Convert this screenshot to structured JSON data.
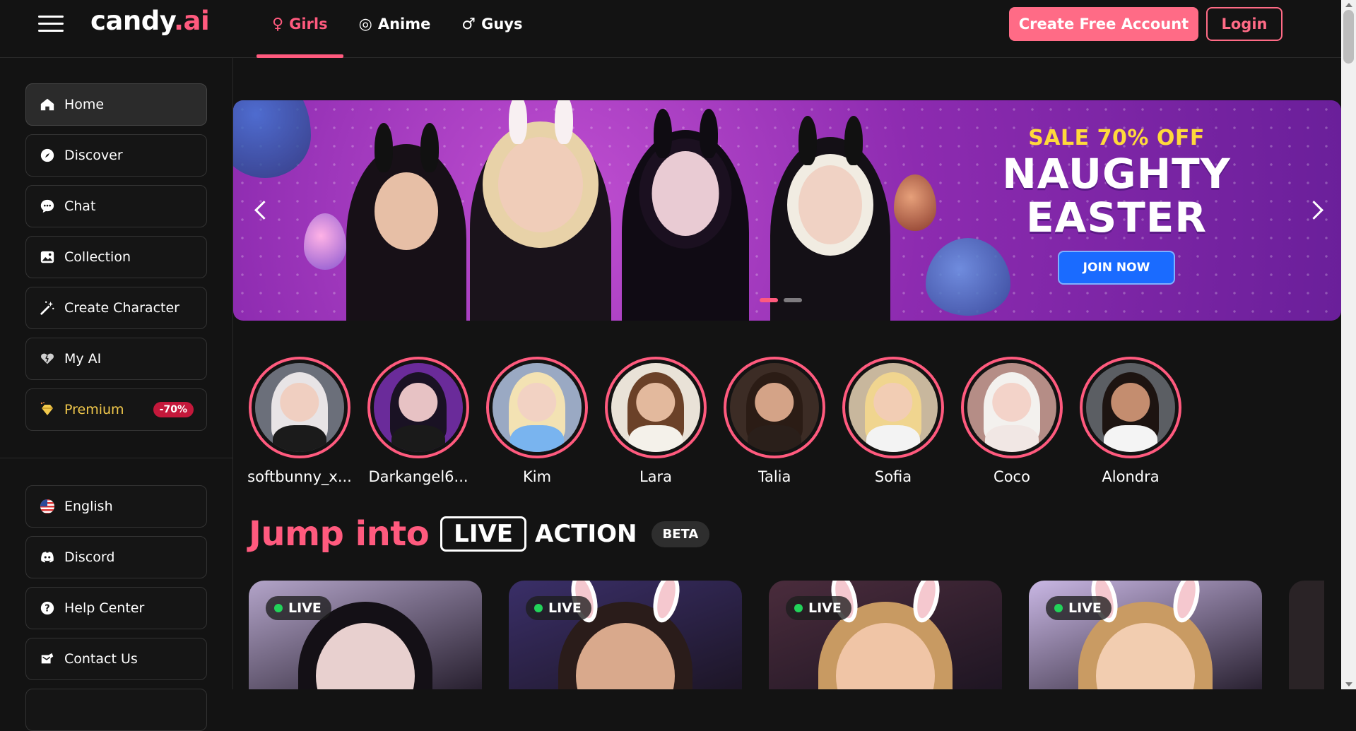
{
  "header": {
    "logo_main": "candy",
    "logo_accent": ".ai",
    "tabs": [
      {
        "label": "Girls",
        "icon": "female-icon",
        "symbol": "♀"
      },
      {
        "label": "Anime",
        "icon": "anime-icon",
        "symbol": "◎"
      },
      {
        "label": "Guys",
        "icon": "male-icon",
        "symbol": "♂"
      }
    ],
    "active_tab": "Girls",
    "create_account_label": "Create Free Account",
    "login_label": "Login"
  },
  "sidebar": {
    "items": [
      {
        "label": "Home",
        "icon": "home-icon"
      },
      {
        "label": "Discover",
        "icon": "compass-icon"
      },
      {
        "label": "Chat",
        "icon": "chat-icon"
      },
      {
        "label": "Collection",
        "icon": "image-icon"
      },
      {
        "label": "Create Character",
        "icon": "magic-wand-icon"
      },
      {
        "label": "My AI",
        "icon": "hearts-icon"
      },
      {
        "label": "Premium",
        "icon": "diamond-icon",
        "badge": "-70%"
      }
    ],
    "footer_items": [
      {
        "label": "English",
        "icon": "us-flag-icon"
      },
      {
        "label": "Discord",
        "icon": "discord-icon"
      },
      {
        "label": "Help Center",
        "icon": "help-icon"
      },
      {
        "label": "Contact Us",
        "icon": "contact-icon"
      }
    ]
  },
  "banner": {
    "sale_text": "SALE 70% OFF",
    "headline_1": "NAUGHTY",
    "headline_2": "EASTER",
    "cta_label": "JOIN NOW"
  },
  "stories": [
    {
      "name": "softbunny_x...",
      "hair": "#e8e4e6",
      "skin": "#f0cfc1",
      "bg": "#6b6f7a",
      "body": "#1b1b1b"
    },
    {
      "name": "Darkangel6...",
      "hair": "#1a1224",
      "skin": "#e7c2c4",
      "bg": "#6a2b9a",
      "body": "#1a1a1a"
    },
    {
      "name": "Kim",
      "hair": "#f3e2b3",
      "skin": "#f2d2c3",
      "bg": "#9aa9c3",
      "body": "#79b4ef"
    },
    {
      "name": "Lara",
      "hair": "#6b4128",
      "skin": "#e3b99d",
      "bg": "#e9e2d7",
      "body": "#f4f1ea"
    },
    {
      "name": "Talia",
      "hair": "#2b1c15",
      "skin": "#d4a387",
      "bg": "#3c2c25",
      "body": "#2a1f1a"
    },
    {
      "name": "Sofia",
      "hair": "#f0d58f",
      "skin": "#f2cdb4",
      "bg": "#c8b79d",
      "body": "#f3f3f3"
    },
    {
      "name": "Coco",
      "hair": "#f3f1ee",
      "skin": "#f3d3c9",
      "bg": "#b58d86",
      "body": "#f1e7e4"
    },
    {
      "name": "Alondra",
      "hair": "#1d1411",
      "skin": "#c48d6f",
      "bg": "#5b5e63",
      "body": "#f4f4f4"
    }
  ],
  "live_section": {
    "jump_text": "Jump into",
    "live_text": "LIVE",
    "action_text": "ACTION",
    "beta_label": "BETA",
    "cards": [
      {
        "pill": "LIVE",
        "hair": "#141016",
        "skin": "#e8d0cf",
        "bg": "#b3a4c9",
        "ears": false
      },
      {
        "pill": "LIVE",
        "hair": "#2a1c1a",
        "skin": "#d9a98c",
        "bg": "#3a2f68",
        "ears": true
      },
      {
        "pill": "LIVE",
        "hair": "#c89a62",
        "skin": "#f0c5a6",
        "bg": "#4a2c3c",
        "ears": true
      },
      {
        "pill": "LIVE",
        "hair": "#c99b63",
        "skin": "#f2cdb0",
        "bg": "#c9b7e4",
        "ears": true
      }
    ]
  }
}
